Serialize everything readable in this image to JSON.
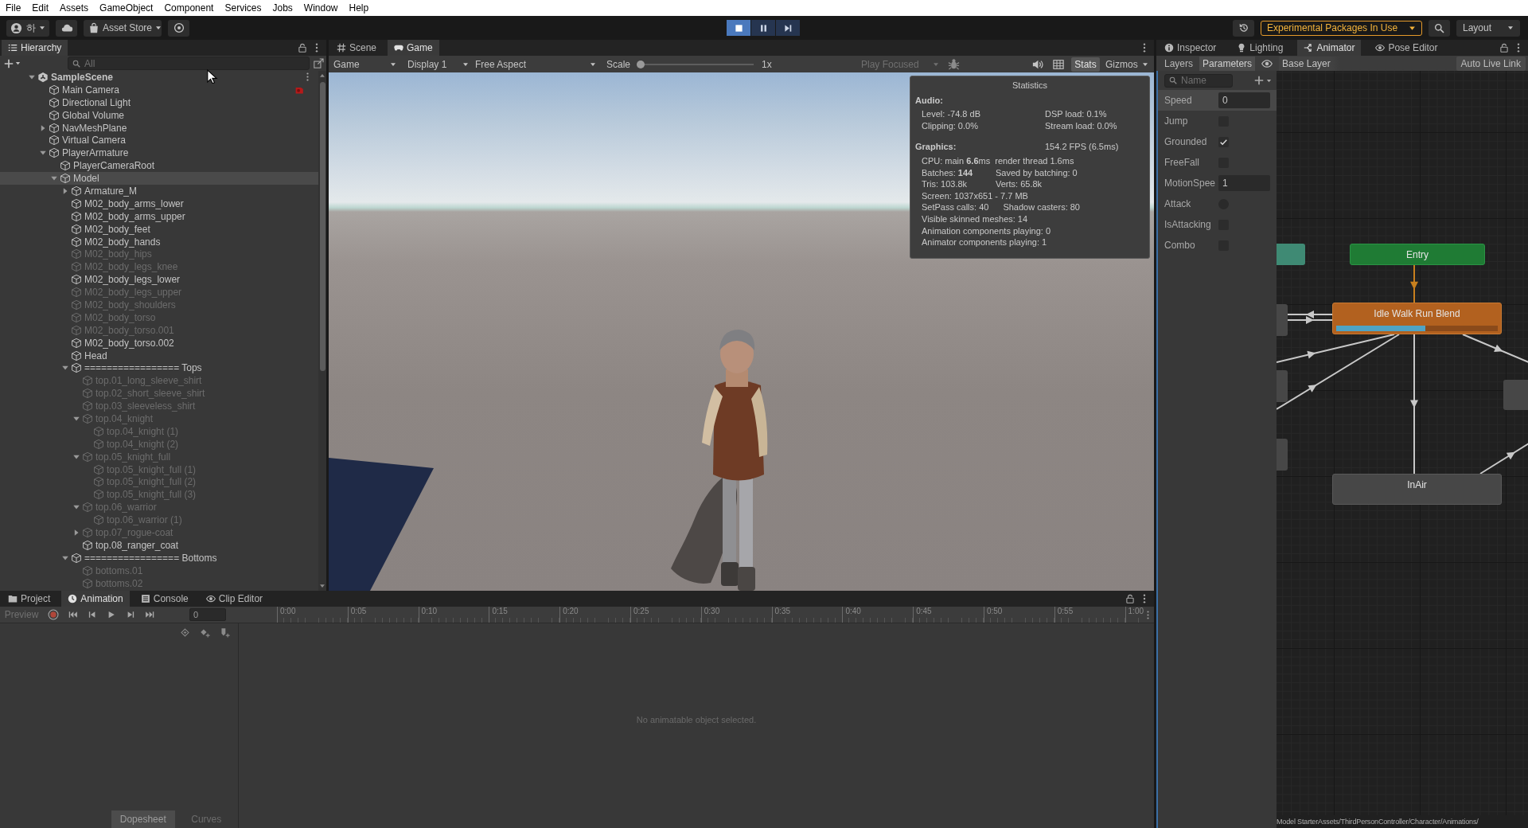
{
  "menu_bar": [
    "File",
    "Edit",
    "Assets",
    "GameObject",
    "Component",
    "Services",
    "Jobs",
    "Window",
    "Help"
  ],
  "toolbar": {
    "account": "하",
    "asset_store": "Asset Store",
    "play_controls": [
      {
        "kind": "stop",
        "on": true
      },
      {
        "kind": "pause",
        "on": false
      },
      {
        "kind": "step",
        "on": false
      }
    ],
    "notice": "Experimental Packages In Use",
    "layout": "Layout"
  },
  "hierarchy": {
    "tab": "Hierarchy",
    "search": {
      "placeholder": "All"
    },
    "items": [
      {
        "name": "SampleScene",
        "kind": "scene",
        "expanded": true,
        "active": true,
        "selected": false,
        "children": [
          {
            "name": "Main Camera",
            "kind": "leaf",
            "expanded": false,
            "active": true,
            "selected": false,
            "badge": true
          },
          {
            "name": "Directional Light",
            "kind": "leaf",
            "expanded": false,
            "active": true,
            "selected": false
          },
          {
            "name": "Global Volume",
            "kind": "leaf",
            "expanded": false,
            "active": true,
            "selected": false
          },
          {
            "name": "NavMeshPlane",
            "kind": "parent",
            "expanded": false,
            "active": true,
            "selected": false
          },
          {
            "name": "Virtual Camera",
            "kind": "leaf",
            "expanded": false,
            "active": true,
            "selected": false
          },
          {
            "name": "PlayerArmature",
            "kind": "parent",
            "expanded": true,
            "active": true,
            "selected": false,
            "children": [
              {
                "name": "PlayerCameraRoot",
                "kind": "leaf",
                "expanded": false,
                "active": true,
                "selected": false
              },
              {
                "name": "Model",
                "kind": "parent",
                "expanded": true,
                "active": true,
                "selected": true,
                "children": [
                  {
                    "name": "Armature_M",
                    "kind": "parent",
                    "expanded": false,
                    "active": true,
                    "selected": false
                  },
                  {
                    "name": "M02_body_arms_lower",
                    "kind": "leaf",
                    "expanded": false,
                    "active": true,
                    "selected": false
                  },
                  {
                    "name": "M02_body_arms_upper",
                    "kind": "leaf",
                    "expanded": false,
                    "active": true,
                    "selected": false
                  },
                  {
                    "name": "M02_body_feet",
                    "kind": "leaf",
                    "expanded": false,
                    "active": true,
                    "selected": false
                  },
                  {
                    "name": "M02_body_hands",
                    "kind": "leaf",
                    "expanded": false,
                    "active": true,
                    "selected": false
                  },
                  {
                    "name": "M02_body_hips",
                    "kind": "leaf",
                    "expanded": false,
                    "active": false,
                    "selected": false
                  },
                  {
                    "name": "M02_body_legs_knee",
                    "kind": "leaf",
                    "expanded": false,
                    "active": false,
                    "selected": false
                  },
                  {
                    "name": "M02_body_legs_lower",
                    "kind": "leaf",
                    "expanded": false,
                    "active": true,
                    "selected": false
                  },
                  {
                    "name": "M02_body_legs_upper",
                    "kind": "leaf",
                    "expanded": false,
                    "active": false,
                    "selected": false
                  },
                  {
                    "name": "M02_body_shoulders",
                    "kind": "leaf",
                    "expanded": false,
                    "active": false,
                    "selected": false
                  },
                  {
                    "name": "M02_body_torso",
                    "kind": "leaf",
                    "expanded": false,
                    "active": false,
                    "selected": false
                  },
                  {
                    "name": "M02_body_torso.001",
                    "kind": "leaf",
                    "expanded": false,
                    "active": false,
                    "selected": false
                  },
                  {
                    "name": "M02_body_torso.002",
                    "kind": "leaf",
                    "expanded": false,
                    "active": true,
                    "selected": false
                  },
                  {
                    "name": "Head",
                    "kind": "leaf",
                    "expanded": false,
                    "active": true,
                    "selected": false
                  },
                  {
                    "name": "================= Tops",
                    "kind": "parent",
                    "expanded": true,
                    "active": true,
                    "selected": false,
                    "children": [
                      {
                        "name": "top.01_long_sleeve_shirt",
                        "kind": "leaf",
                        "expanded": false,
                        "active": false,
                        "selected": false
                      },
                      {
                        "name": "top.02_short_sleeve_shirt",
                        "kind": "leaf",
                        "expanded": false,
                        "active": false,
                        "selected": false
                      },
                      {
                        "name": "top.03_sleeveless_shirt",
                        "kind": "leaf",
                        "expanded": false,
                        "active": false,
                        "selected": false
                      },
                      {
                        "name": "top.04_knight",
                        "kind": "parent",
                        "expanded": true,
                        "active": false,
                        "selected": false,
                        "children": [
                          {
                            "name": "top.04_knight (1)",
                            "kind": "leaf",
                            "expanded": false,
                            "active": false,
                            "selected": false
                          },
                          {
                            "name": "top.04_knight (2)",
                            "kind": "leaf",
                            "expanded": false,
                            "active": false,
                            "selected": false
                          }
                        ]
                      },
                      {
                        "name": "top.05_knight_full",
                        "kind": "parent",
                        "expanded": true,
                        "active": false,
                        "selected": false,
                        "children": [
                          {
                            "name": "top.05_knight_full (1)",
                            "kind": "leaf",
                            "expanded": false,
                            "active": false,
                            "selected": false
                          },
                          {
                            "name": "top.05_knight_full (2)",
                            "kind": "leaf",
                            "expanded": false,
                            "active": false,
                            "selected": false
                          },
                          {
                            "name": "top.05_knight_full (3)",
                            "kind": "leaf",
                            "expanded": false,
                            "active": false,
                            "selected": false
                          }
                        ]
                      },
                      {
                        "name": "top.06_warrior",
                        "kind": "parent",
                        "expanded": true,
                        "active": false,
                        "selected": false,
                        "children": [
                          {
                            "name": "top.06_warrior (1)",
                            "kind": "leaf",
                            "expanded": false,
                            "active": false,
                            "selected": false
                          }
                        ]
                      },
                      {
                        "name": "top.07_rogue-coat",
                        "kind": "parent",
                        "expanded": false,
                        "active": false,
                        "selected": false
                      },
                      {
                        "name": "top.08_ranger_coat",
                        "kind": "leaf",
                        "expanded": false,
                        "active": true,
                        "selected": false
                      }
                    ]
                  },
                  {
                    "name": "================= Bottoms",
                    "kind": "parent",
                    "expanded": true,
                    "active": true,
                    "selected": false,
                    "children": [
                      {
                        "name": "bottoms.01",
                        "kind": "leaf",
                        "expanded": false,
                        "active": false,
                        "selected": false
                      },
                      {
                        "name": "bottoms.02",
                        "kind": "leaf",
                        "expanded": false,
                        "active": false,
                        "selected": false
                      }
                    ]
                  }
                ]
              }
            ]
          }
        ]
      }
    ]
  },
  "game": {
    "tabs": [
      {
        "label": "Scene",
        "selected": false
      },
      {
        "label": "Game",
        "selected": true
      }
    ],
    "toolbar": {
      "view": "Game",
      "display": "Display 1",
      "aspect": "Free Aspect",
      "scale_label": "Scale",
      "scale": {
        "level": 0
      },
      "scale_value": "1x",
      "play_mode": "Play Focused",
      "stats": {
        "label": "Stats",
        "on": true
      },
      "gizmos": "Gizmos"
    },
    "statistics": {
      "title": "Statistics",
      "audio": {
        "heading": "Audio:",
        "rows": [
          [
            "Level: -74.8 dB",
            "DSP load: 0.1%"
          ],
          [
            "Clipping: 0.0%",
            "Stream load: 0.0%"
          ]
        ]
      },
      "graphics": {
        "heading": "Graphics:",
        "fps": "154.2 FPS (6.5ms)",
        "rows": [
          [
            "CPU: main **6.6**ms  render thread 1.6ms"
          ],
          [
            "Batches: **144**",
            "Saved by batching: 0"
          ],
          [
            "Tris: 103.8k",
            "Verts: 65.8k"
          ],
          [
            "Screen: 1037x651 - 7.7 MB"
          ],
          [
            "SetPass calls: 40",
            "Shadow casters: 80"
          ],
          [
            "Visible skinned meshes: 14"
          ],
          [
            "Animation components playing: 0"
          ],
          [
            "Animator components playing: 1"
          ]
        ]
      }
    }
  },
  "right_panel": {
    "tabs": [
      {
        "label": "Inspector",
        "selected": false
      },
      {
        "label": "Lighting",
        "selected": false
      },
      {
        "label": "Animator",
        "selected": true
      },
      {
        "label": "Pose Editor",
        "selected": false
      }
    ]
  },
  "animator": {
    "subtabs": [
      {
        "label": "Layers",
        "selected": false
      },
      {
        "label": "Parameters",
        "selected": true
      }
    ],
    "breadcrumb": "Base Layer",
    "live_link": "Auto Live Link",
    "search": {
      "placeholder": "Name"
    },
    "parameters": [
      {
        "name": "Speed",
        "kind": "float",
        "value": "0",
        "selected": true
      },
      {
        "name": "Jump",
        "kind": "bool",
        "checked": false,
        "selected": false
      },
      {
        "name": "Grounded",
        "kind": "bool",
        "checked": true,
        "selected": false
      },
      {
        "name": "FreeFall",
        "kind": "bool",
        "checked": false,
        "selected": false
      },
      {
        "name": "MotionSpee",
        "kind": "float",
        "value": "1",
        "selected": false
      },
      {
        "name": "Attack",
        "kind": "trigger",
        "checked": false,
        "selected": false
      },
      {
        "name": "IsAttacking",
        "kind": "bool",
        "checked": false,
        "selected": false
      },
      {
        "name": "Combo",
        "kind": "bool",
        "checked": false,
        "selected": false
      }
    ],
    "states": [
      {
        "name": "Entry",
        "kind": "entry"
      },
      {
        "name": "Idle Walk Run Blend",
        "kind": "default",
        "level": 0.55
      },
      {
        "name": "InAir",
        "kind": "normal"
      }
    ],
    "asset_path": "Model StarterAssets/ThirdPersonController/Character/Animations/"
  },
  "bottom_panel": {
    "tabs": [
      {
        "label": "Project",
        "selected": false
      },
      {
        "label": "Animation",
        "selected": true
      },
      {
        "label": "Console",
        "selected": false
      },
      {
        "label": "Clip Editor",
        "selected": false
      }
    ],
    "animation": {
      "preview": {
        "label": "Preview",
        "disabled": true
      },
      "frame": "0",
      "ruler": [
        "0:00",
        "0:05",
        "0:10",
        "0:15",
        "0:20",
        "0:25",
        "0:30",
        "0:35",
        "0:40",
        "0:45",
        "0:50",
        "0:55",
        "1:00"
      ],
      "modes": [
        {
          "label": "Dopesheet",
          "selected": true
        },
        {
          "label": "Curves",
          "selected": false
        }
      ],
      "message": "No animatable object selected."
    }
  }
}
